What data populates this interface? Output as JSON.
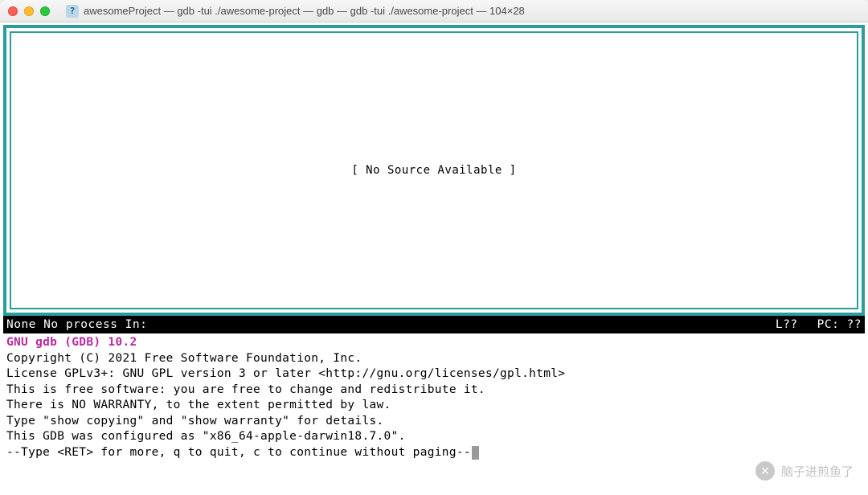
{
  "window": {
    "title": "awesomeProject — gdb -tui ./awesome-project — gdb — gdb -tui ./awesome-project — 104×28",
    "icon_glyph": "?"
  },
  "source_pane": {
    "message": "[ No Source Available ]"
  },
  "status_bar": {
    "left": "None No process In:",
    "line": "L??",
    "pc": "PC: ??"
  },
  "gdb": {
    "header": "GNU gdb (GDB) 10.2",
    "lines": [
      "Copyright (C) 2021 Free Software Foundation, Inc.",
      "License GPLv3+: GNU GPL version 3 or later <http://gnu.org/licenses/gpl.html>",
      "This is free software: you are free to change and redistribute it.",
      "There is NO WARRANTY, to the extent permitted by law.",
      "Type \"show copying\" and \"show warranty\" for details.",
      "This GDB was configured as \"x86_64-apple-darwin18.7.0\"."
    ],
    "prompt": "--Type <RET> for more, q to quit, c to continue without paging--"
  },
  "watermark": {
    "icon_glyph": "✕",
    "text": "脑子进煎鱼了"
  }
}
